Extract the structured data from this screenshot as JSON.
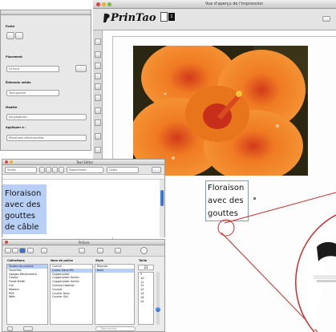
{
  "main_window": {
    "title": "Vue d'aperçu de l'impression",
    "logo_text": "PrinTao",
    "page_badge": "1"
  },
  "inspector": {
    "section_fonte": "Fonte",
    "section_placement": "Placement",
    "placement_value": "Le haut",
    "section_elements": "Éléments média",
    "elements_value": "Tout gauche",
    "section_modele": "Modèle",
    "modele_value": "Sauvegarder...",
    "section_appliquer": "Appliquer à :",
    "appliquer_value": "Miniatures sélectionnées"
  },
  "text_editor": {
    "title": "Text Editor",
    "styles_label": "Styles",
    "espacement_label": "Espacement",
    "listes_label": "Listes",
    "text_lines": [
      "Floraison",
      "avec des",
      "gouttes",
      "de câble"
    ]
  },
  "caption": {
    "lines": [
      "Floraison",
      "avec des",
      "gouttes"
    ]
  },
  "fonts_panel": {
    "title": "Polices",
    "col_collections": "Collections",
    "col_family": "Nom de police",
    "col_style": "Style",
    "col_size": "Taille",
    "collections": [
      "Toutes les polices",
      "Favorites",
      "Usages Récemment",
      "Classic",
      "Fixed Width",
      "Fun",
      "Modern",
      "PDF",
      "Web"
    ],
    "families": [
      "Cochin",
      "Comic Sans MS",
      "Copperplate",
      "Copperplate Gothic",
      "Copperplate Gothic",
      "Corsiva Hebrew",
      "Courier",
      "Courier New",
      "Courier Std"
    ],
    "styles": [
      "Regular",
      "Bold"
    ],
    "size_value": "23",
    "sizes": [
      "9",
      "10",
      "11",
      "12",
      "13",
      "14",
      "18",
      "24"
    ],
    "search_placeholder": "Rechercher"
  },
  "colors": {
    "selection": "#b8d0f5",
    "flower_orange": "#e8741c",
    "callout_red": "#cc2b2b",
    "window_bg": "#e8e8e8"
  }
}
